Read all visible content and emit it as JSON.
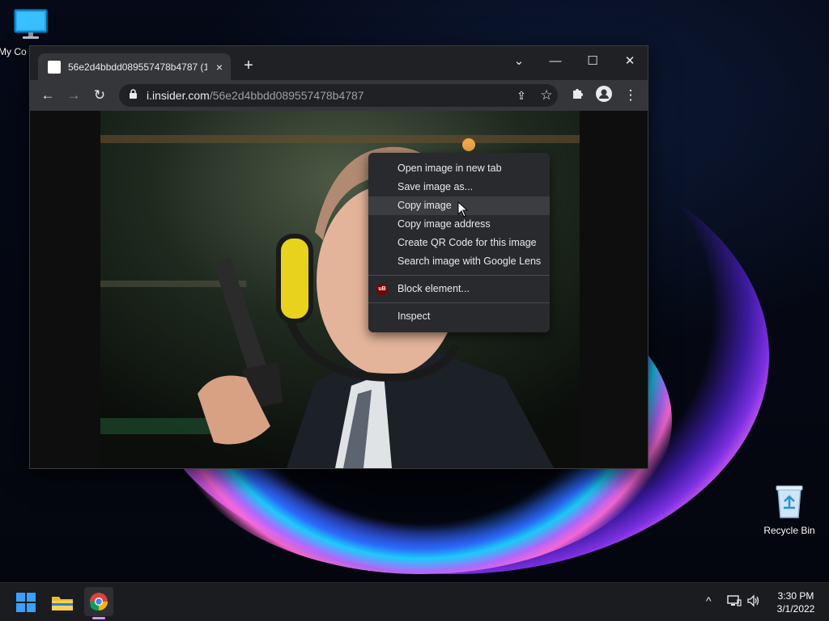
{
  "desktop": {
    "icons": [
      {
        "label": "My Co"
      },
      {
        "label": "Recycle Bin"
      }
    ]
  },
  "browser": {
    "tab": {
      "title": "56e2d4bbdd089557478b4787 (1",
      "close_glyph": "×"
    },
    "new_tab_glyph": "+",
    "controls": {
      "tab_search": "⌄",
      "minimize": "—",
      "maximize": "☐",
      "close": "✕"
    },
    "toolbar": {
      "back": "←",
      "forward": "→",
      "reload": "↻",
      "lock": "🔒",
      "url_domain": "i.insider.com",
      "url_path": "/56e2d4bbdd089557478b4787",
      "share": "⇪",
      "star": "☆",
      "extensions": "✱",
      "menu": "⋮"
    }
  },
  "context_menu": {
    "items": [
      {
        "label": "Open image in new tab"
      },
      {
        "label": "Save image as..."
      },
      {
        "label": "Copy image",
        "hovered": true
      },
      {
        "label": "Copy image address"
      },
      {
        "label": "Create QR Code for this image"
      },
      {
        "label": "Search image with Google Lens"
      },
      {
        "label": "Block element...",
        "icon": "ublock-origin-icon",
        "icon_text": "uB"
      },
      {
        "label": "Inspect"
      }
    ]
  },
  "taskbar": {
    "tray_chevron": "^",
    "clock": {
      "time": "3:30 PM",
      "date": "3/1/2022"
    },
    "indicator_color": "#c79af5"
  }
}
